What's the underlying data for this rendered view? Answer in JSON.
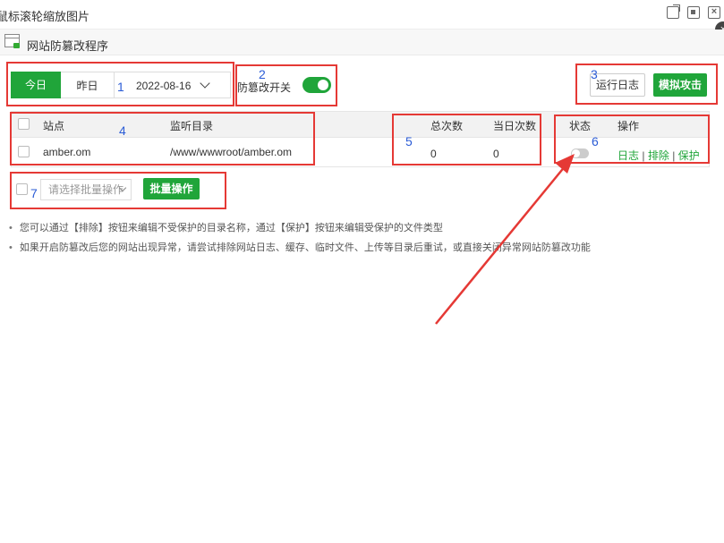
{
  "window": {
    "title": "鼠标滚轮缩放图片",
    "icons": [
      "open-external-icon",
      "maximize-icon",
      "close-icon"
    ],
    "corner_close": "×"
  },
  "app": {
    "title": "网站防篡改程序"
  },
  "filters": {
    "today": "今日",
    "yesterday": "昨日",
    "date": "2022-08-16"
  },
  "switch": {
    "label": "防篡改开关",
    "on": true
  },
  "actions": {
    "run_log": "运行日志",
    "simulate_attack": "模拟攻击"
  },
  "table": {
    "headers": {
      "site": "站点",
      "dir": "监听目录",
      "total": "总次数",
      "today": "当日次数",
      "status": "状态",
      "ops": "操作"
    },
    "rows": [
      {
        "site": "amber.om",
        "dir": "/www/wwwroot/amber.om",
        "total": "0",
        "today": "0",
        "status_on": false,
        "ops": {
          "log": "日志",
          "sep": "|",
          "exclude": "排除",
          "protect": "保护"
        }
      }
    ]
  },
  "batch": {
    "placeholder": "请选择批量操作",
    "button": "批量操作"
  },
  "tips": [
    "您可以通过【排除】按钮来编辑不受保护的目录名称，通过【保护】按钮来编辑受保护的文件类型",
    "如果开启防篡改后您的网站出现异常，请尝试排除网站日志、缓存、临时文件、上传等目录后重试，或直接关闭异常网站防篡改功能"
  ],
  "annotations": {
    "labels": [
      "1",
      "2",
      "3",
      "4",
      "5",
      "6",
      "7"
    ],
    "color": "#e53935"
  },
  "colors": {
    "accent": "#20a53a",
    "annotation_number": "#2b5cd6"
  }
}
